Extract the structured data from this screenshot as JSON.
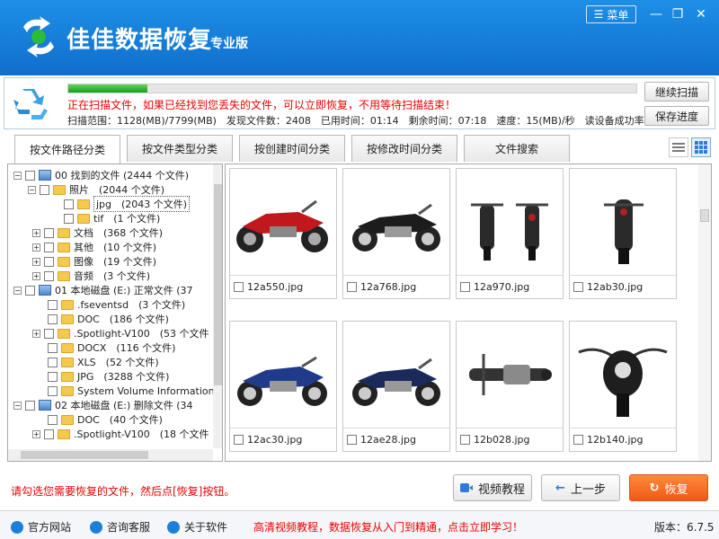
{
  "app": {
    "title": "佳佳数据恢复",
    "edition": "专业版",
    "menu_label": "菜单"
  },
  "colors": {
    "brand": "#1e8fe6",
    "alert": "#e00000",
    "accent_orange": "#f46b1e",
    "progress_green": "#2bb02b"
  },
  "scan": {
    "progress_percent": 14,
    "message": "正在扫描文件，如果已经找到您丢失的文件，可以立即恢复，不用等待扫描结束！",
    "stats": "扫描范围：1128(MB)/7799(MB)　发现文件数：2408　已用时间：01:14　剩余时间：07:18　速度：15(MB)/秒　读设备成功率:",
    "continue_label": "继续扫描",
    "save_label": "保存进度"
  },
  "tabs": [
    {
      "label": "按文件路径分类"
    },
    {
      "label": "按文件类型分类"
    },
    {
      "label": "按创建时间分类"
    },
    {
      "label": "按修改时间分类"
    },
    {
      "label": "文件搜索"
    }
  ],
  "tree": [
    {
      "text": "00 找到的文件 (2444 个文件)"
    },
    {
      "text": "照片　(2044 个文件)"
    },
    {
      "text": "jpg　(2043 个文件)"
    },
    {
      "text": "tif　(1 个文件)"
    },
    {
      "text": "文档　(368 个文件)"
    },
    {
      "text": "其他　(10 个文件)"
    },
    {
      "text": "图像　(19 个文件)"
    },
    {
      "text": "音频　(3 个文件)"
    },
    {
      "text": "01 本地磁盘 (E:) 正常文件 (37"
    },
    {
      "text": ".fseventsd　(3 个文件)"
    },
    {
      "text": "DOC　(186 个文件)"
    },
    {
      "text": ".Spotlight-V100　(53 个文件"
    },
    {
      "text": "DOCX　(116 个文件)"
    },
    {
      "text": "XLS　(52 个文件)"
    },
    {
      "text": "JPG　(3288 个文件)"
    },
    {
      "text": "System Volume Information"
    },
    {
      "text": "02 本地磁盘 (E:) 删除文件 (34"
    },
    {
      "text": "DOC　(40 个文件)"
    },
    {
      "text": ".Spotlight-V100　(18 个文件"
    }
  ],
  "files": [
    {
      "name": "12a550.jpg"
    },
    {
      "name": "12a768.jpg"
    },
    {
      "name": "12a970.jpg"
    },
    {
      "name": "12ab30.jpg"
    },
    {
      "name": "12ac30.jpg"
    },
    {
      "name": "12ae28.jpg"
    },
    {
      "name": "12b028.jpg"
    },
    {
      "name": "12b140.jpg"
    }
  ],
  "bottom": {
    "hint": "请勾选您需要恢复的文件，然后点[恢复]按钮。",
    "video_label": "视频教程",
    "prev_label": "上一步",
    "recover_label": "恢复"
  },
  "statusbar": {
    "website": "官方网站",
    "support": "咨询客服",
    "about": "关于软件",
    "promo": "高清视频教程，数据恢复从入门到精通，点击立即学习！",
    "version": "版本：6.7.5"
  }
}
